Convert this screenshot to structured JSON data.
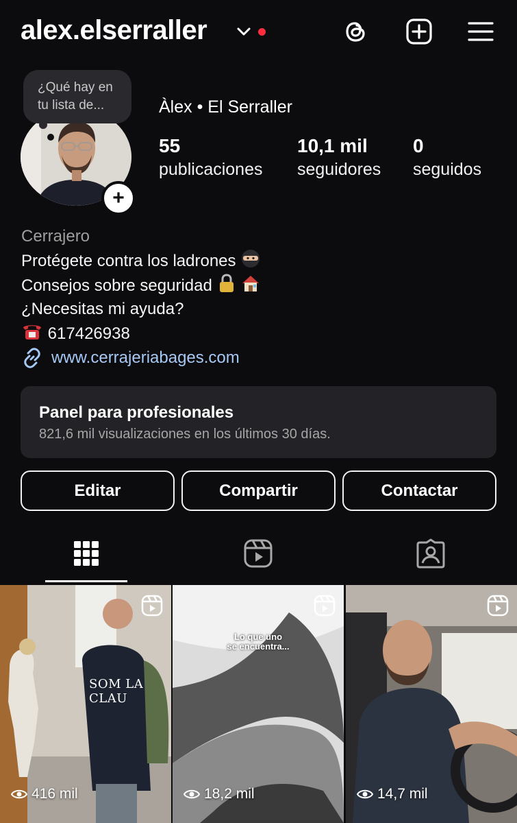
{
  "header": {
    "username": "alex.elserraller",
    "icons": [
      "chevron-down-icon",
      "threads-icon",
      "new-post-icon",
      "menu-icon"
    ],
    "notification_color": "#ff2e3f"
  },
  "note_bubble": {
    "line1": "¿Qué hay en",
    "line2": "tu lista de..."
  },
  "profile": {
    "full_name": "Àlex • El Serraller",
    "stats": [
      {
        "value": "55",
        "label": "publicaciones"
      },
      {
        "value": "10,1 mil",
        "label": "seguidores"
      },
      {
        "value": "0",
        "label": "seguidos"
      }
    ],
    "add_story_label": "+"
  },
  "bio": {
    "category": "Cerrajero",
    "line1": "Protégete contra los ladrones",
    "line2": "Consejos sobre seguridad",
    "line3": "¿Necesitas mi ayuda?",
    "phone": "617426938",
    "link": "www.cerrajeriabages.com",
    "emojis": [
      "ninja",
      "lock",
      "house",
      "telephone"
    ]
  },
  "pro_panel": {
    "title": "Panel para profesionales",
    "subtitle": "821,6 mil visualizaciones en los últimos 30 días."
  },
  "buttons": {
    "edit": "Editar",
    "share": "Compartir",
    "contact": "Contactar"
  },
  "tabs": [
    {
      "icon": "grid-icon",
      "active": true
    },
    {
      "icon": "reels-icon",
      "active": false
    },
    {
      "icon": "tagged-icon",
      "active": false
    }
  ],
  "posts": [
    {
      "views": "416 mil",
      "overlay_text": "SOM LA CLAU"
    },
    {
      "views": "18,2 mil",
      "overlay_text_1": "Lo que uno",
      "overlay_text_2": "se encuentra..."
    },
    {
      "views": "14,7 mil",
      "overlay_text": ""
    }
  ],
  "colors": {
    "background": "#0c0c0f",
    "link": "#a6c8f5",
    "panel": "#232327"
  }
}
